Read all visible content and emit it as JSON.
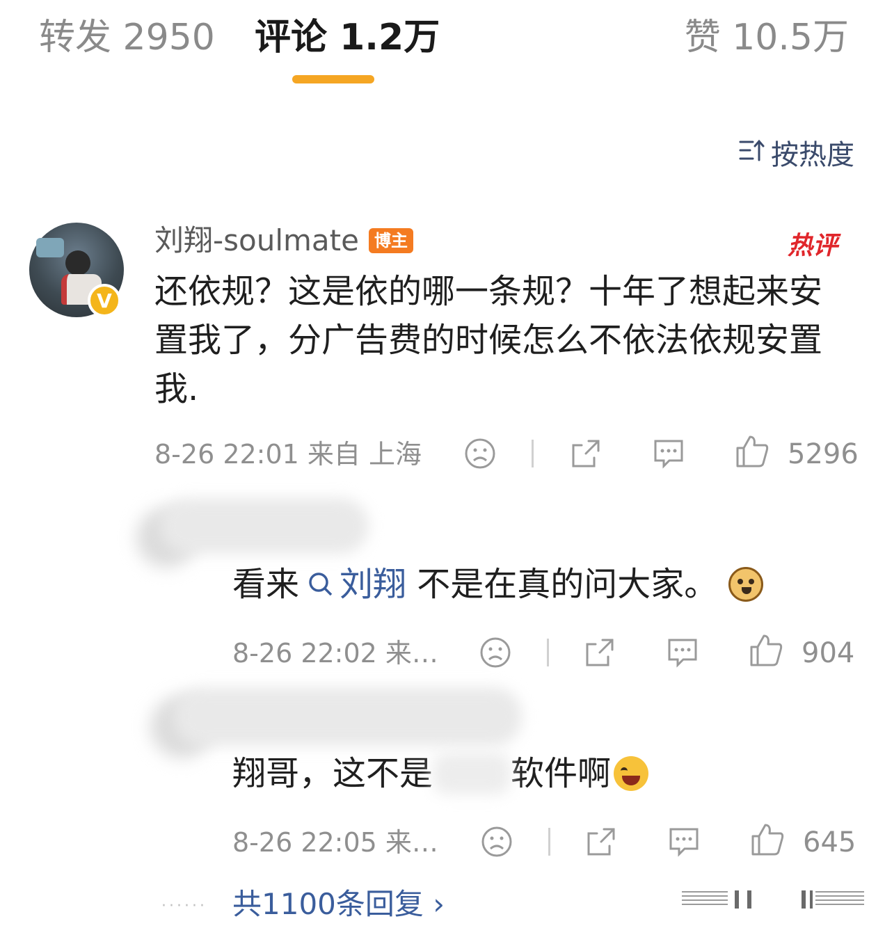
{
  "tabs": {
    "repost": "转发 2950",
    "comments": "评论 1.2万",
    "likes": "赞 10.5万"
  },
  "sort": {
    "label": "按热度",
    "icon": "sort-icon"
  },
  "main_comment": {
    "author": "刘翔-soulmate",
    "badge": "博主",
    "hot_label": "热评",
    "text": "还依规？这是依的哪一条规？十年了想起来安置我了，分广告费的时候怎么不依法依规安置我.",
    "time_location": "8-26 22:01 来自 上海",
    "likes": "5296"
  },
  "replies": [
    {
      "prefix": "看来",
      "mention": "刘翔",
      "suffix": " 不是在真的问大家。",
      "emoji": "doge-emoji",
      "time_location": "8-26 22:02 来…",
      "likes": "904"
    },
    {
      "prefix": "翔哥，这不是",
      "suffix": "软件啊",
      "emoji": "laugh-cry-emoji",
      "time_location": "8-26 22:05 来…",
      "likes": "645"
    }
  ],
  "more_replies": "共1100条回复 ›",
  "colors": {
    "accent": "#f5a623",
    "link": "#3a5d9c",
    "hot": "#e0262b",
    "badge": "#f47b21",
    "muted": "#8f8f8f"
  }
}
